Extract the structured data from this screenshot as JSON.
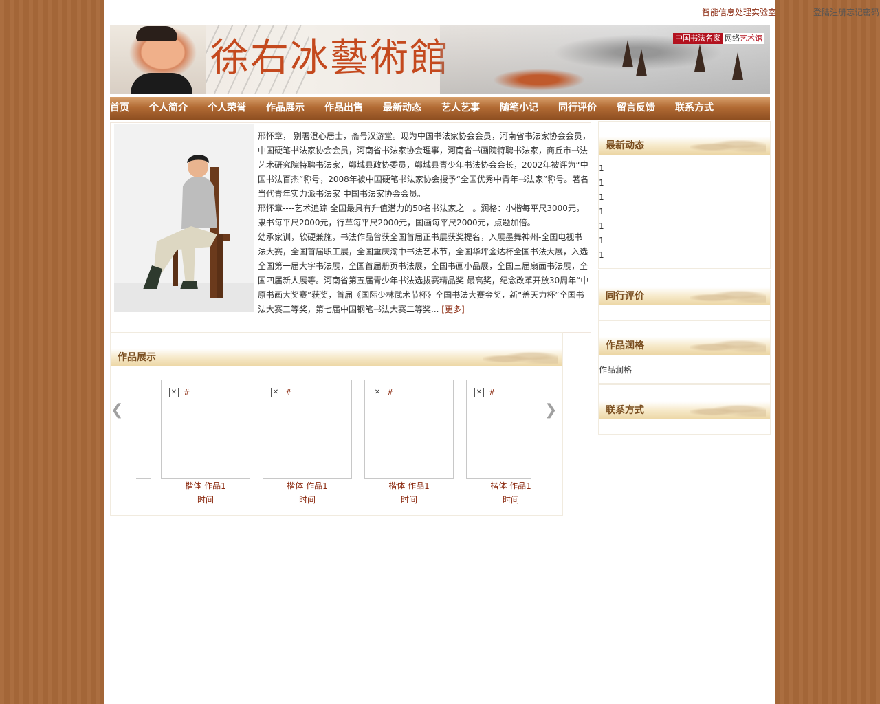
{
  "toplinks": {
    "lab": "智能信息处理实验室",
    "login": "登陆",
    "register": "注册",
    "forgot": "忘记密码"
  },
  "banner": {
    "title": "徐右冰藝術館",
    "logo_red": "中国书法名家",
    "logo_net": "网络",
    "logo_hall": "艺术馆"
  },
  "nav": [
    "首页",
    "个人简介",
    "个人荣誉",
    "作品展示",
    "作品出售",
    "最新动态",
    "艺人艺事",
    "随笔小记",
    "同行评价",
    "留言反馈",
    "联系方式"
  ],
  "intro": {
    "p1": "邢怀章， 别署澄心居士，斋号汉游堂。现为中国书法家协会会员，河南省书法家协会会员，中国硬笔书法家协会会员，河南省书法家协会理事，河南省书画院特聘书法家，商丘市书法艺术研究院特聘书法家，郸城县政协委员，郸城县青少年书法协会会长，2002年被评为“中国书法百杰”称号，2008年被中国硬笔书法家协会授予“全国优秀中青年书法家”称号。著名当代青年实力派书法家 中国书法家协会会员。",
    "p2": "邢怀章----艺术追踪 全国最具有升值潜力的50名书法家之一。润格：小楷每平尺3000元，隶书每平尺2000元，行草每平尺2000元，国画每平尺2000元，点题加倍。",
    "p3": "幼承家训，软硬兼施，书法作品曾获全国首届正书展获奖提名，入展墨舞神州-全国电视书法大赛，全国首届职工展，全国重庆渝中书法艺术节，全国华坪金达杯全国书法大展，入选全国第一届大字书法展，全国首届册页书法展，全国书画小品展，全国三届扇面书法展，全国四届新人展等。河南省第五届青少年书法选拔赛精品奖 最高奖，纪念改革开放30周年“中原书画大奖赛”获奖，首届《国际少林武术节杯》全国书法大赛金奖，新“盖天力杯”全国书法大赛三等奖，第七届中国钢笔书法大赛二等奖...",
    "more": "[更多]"
  },
  "works": {
    "title": "作品展示",
    "items": [
      {
        "alt": "#",
        "name": "楷体  作品1",
        "time": "时间"
      },
      {
        "alt": "#",
        "name": "楷体  作品1",
        "time": "时间"
      },
      {
        "alt": "#",
        "name": "楷体  作品1",
        "time": "时间"
      },
      {
        "alt": "#",
        "name": "楷体  作品1",
        "time": "时间"
      }
    ]
  },
  "side": {
    "news_title": "最新动态",
    "news_items": [
      "1",
      "1",
      "1",
      "1",
      "1",
      "1",
      "1"
    ],
    "peer_title": "同行评价",
    "price_title": "作品润格",
    "price_text": "作品润格",
    "contact_title": "联系方式"
  }
}
